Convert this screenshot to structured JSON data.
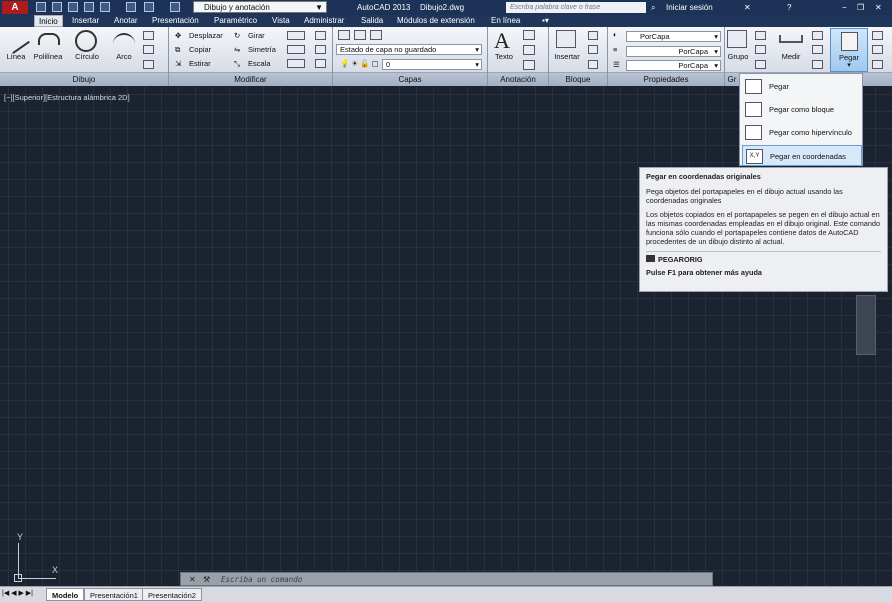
{
  "titlebar": {
    "workspace": "Dibujo y anotación",
    "app_title": "AutoCAD 2013",
    "file_name": "Dibujo2.dwg",
    "search_placeholder": "Escriba palabra clave o frase",
    "signin": "Iniciar sesión"
  },
  "tabs": [
    "Inicio",
    "Insertar",
    "Anotar",
    "Presentación",
    "Paramétrico",
    "Vista",
    "Administrar",
    "Salida",
    "Módulos de extensión",
    "En línea"
  ],
  "draw": {
    "line": "Línea",
    "polyline": "Polilínea",
    "circle": "Círculo",
    "arc": "Arco",
    "panel": "Dibujo"
  },
  "modify": {
    "move": "Desplazar",
    "copy": "Copiar",
    "stretch": "Estirar",
    "rotate": "Girar",
    "mirror": "Simetría",
    "scale": "Escala",
    "panel": "Modificar"
  },
  "layers": {
    "state": "Estado de capa no guardado",
    "current": "0",
    "panel": "Capas"
  },
  "annotation": {
    "text": "Texto",
    "panel": "Anotación"
  },
  "block": {
    "insert": "Insertar",
    "panel": "Bloque"
  },
  "properties": {
    "color": "PorCapa",
    "linetype": "PorCapa",
    "lineweight": "PorCapa",
    "panel": "Propiedades"
  },
  "group": {
    "label": "Grupo",
    "panel": "Gr"
  },
  "utilities": {
    "measure": "Medir"
  },
  "clipboard": {
    "paste": "Pegar"
  },
  "viewport": {
    "label": "[−][Superior][Estructura alámbrica 2D]"
  },
  "paste_menu": {
    "items": [
      "Pegar",
      "Pegar como bloque",
      "Pegar como hipervínculo",
      "Pegar en coordenadas originales"
    ]
  },
  "tooltip": {
    "title": "Pegar en coordenadas originales",
    "desc": "Pega objetos del portapapeles en el dibujo actual usando las coordenadas originales",
    "detail": "Los objetos copiados en el portapapeles se pegen en el dibujo actual en las mismas coordenadas empleadas en el dibujo original. Este comando funciona sólo cuando el portapapeles contiene datos de AutoCAD procedentes de un dibujo distinto al actual.",
    "command": "PEGARORIG",
    "help": "Pulse F1 para obtener más ayuda"
  },
  "command": {
    "placeholder": "Escriba un comando"
  },
  "layout_tabs": [
    "Modelo",
    "Presentación1",
    "Presentación2"
  ],
  "ucs": {
    "x": "X",
    "y": "Y"
  }
}
